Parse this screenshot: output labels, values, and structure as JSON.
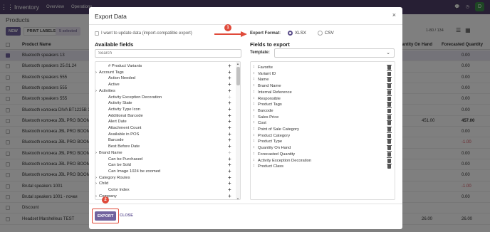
{
  "app": {
    "title": "Inventory",
    "menu": [
      "Overview",
      "Operations"
    ],
    "avatar_letter": "D"
  },
  "page": {
    "breadcrumb": "Products",
    "new_label": "NEW",
    "print_labels": "PRINT LABELS",
    "selected_badge": "5 selected",
    "pager": "1-80 / 134"
  },
  "table": {
    "headers": {
      "name": "Product Name",
      "on_hand": "Quantity On Hand",
      "forecast": "Forecasted Quantity"
    },
    "rows": [
      {
        "name": "Bluetooth speakers 13",
        "on_hand": "",
        "forecast": "0.00",
        "selected": true
      },
      {
        "name": "Bluetooth speakers 25.01.24",
        "on_hand": "",
        "forecast": "0.00",
        "selected": false
      },
      {
        "name": "Bluetooth speakers 555",
        "on_hand": "",
        "forecast": "0.00",
        "selected": false
      },
      {
        "name": "Bluetooth speakers 555",
        "on_hand": "",
        "forecast": "0.00",
        "selected": false
      },
      {
        "name": "Bluetooth speakers 555",
        "on_hand": "",
        "forecast": "0.00",
        "selected": false
      },
      {
        "name": "Bluetooth колонка DIVA BT1225B 3",
        "on_hand": "",
        "forecast": "0.00",
        "selected": false
      },
      {
        "name": "Bluetooth колонка JBL PRO BOOMBI",
        "on_hand": "451.00",
        "forecast": "457.00",
        "selected": false
      },
      {
        "name": "Bluetooth колонка JBL PRO BOOMBI",
        "on_hand": "",
        "forecast": "0.00",
        "selected": false
      },
      {
        "name": "Bluetooth колонка JBL PRO BOOMBI",
        "on_hand": "",
        "forecast": "-1.00",
        "selected": false
      },
      {
        "name": "Bluetooth колонка JBL PRO BOOMBI",
        "on_hand": "",
        "forecast": "0.00",
        "selected": false
      },
      {
        "name": "Bluetooth колонка JBL PRO BOOMBI",
        "on_hand": "",
        "forecast": "0.00",
        "selected": false
      },
      {
        "name": "Bluetooth колонка JBL PRO BOOMBI",
        "on_hand": "",
        "forecast": "0.00",
        "selected": false
      },
      {
        "name": "Brutal speakers 1001",
        "on_hand": "",
        "forecast": "-1.00",
        "selected": false
      },
      {
        "name": "Brutal speakers 1001 - почки",
        "on_hand": "",
        "forecast": "0.00",
        "selected": false
      },
      {
        "name": "Discount",
        "on_hand": "",
        "forecast": "",
        "selected": false
      },
      {
        "name": "Headset Marshelleus TEST",
        "on_hand": "26.00",
        "forecast": "26.00",
        "selected": false
      }
    ]
  },
  "modal": {
    "title": "Export Data",
    "close_icon": "×",
    "import_compat_label": "I want to update data (import-compatible export)",
    "export_format_label": "Export Format:",
    "formats": [
      {
        "label": "XLSX",
        "checked": true
      },
      {
        "label": "CSV",
        "checked": false
      }
    ],
    "available_title": "Available fields",
    "search_placeholder": "Search",
    "export_title": "Fields to export",
    "template_label": "Template:",
    "available_fields": [
      {
        "label": "# Product Variants",
        "expandable": false,
        "can_add": true
      },
      {
        "label": "Account Tags",
        "expandable": true,
        "can_add": true
      },
      {
        "label": "Action Needed",
        "expandable": false,
        "can_add": true
      },
      {
        "label": "Active",
        "expandable": false,
        "can_add": true
      },
      {
        "label": "Activities",
        "expandable": true,
        "can_add": true
      },
      {
        "label": "Activity Exception Decoration",
        "expandable": false,
        "can_add": false
      },
      {
        "label": "Activity State",
        "expandable": false,
        "can_add": true
      },
      {
        "label": "Activity Type Icon",
        "expandable": false,
        "can_add": true
      },
      {
        "label": "Additional Barcode",
        "expandable": false,
        "can_add": true
      },
      {
        "label": "Alert Date",
        "expandable": false,
        "can_add": true
      },
      {
        "label": "Attachment Count",
        "expandable": false,
        "can_add": true
      },
      {
        "label": "Available in POS",
        "expandable": false,
        "can_add": true
      },
      {
        "label": "Barcode",
        "expandable": false,
        "can_add": true
      },
      {
        "label": "Best Before Date",
        "expandable": false,
        "can_add": true
      },
      {
        "label": "Brand Name",
        "expandable": true,
        "can_add": false
      },
      {
        "label": "Can be Purchased",
        "expandable": false,
        "can_add": true
      },
      {
        "label": "Can be Sold",
        "expandable": false,
        "can_add": true
      },
      {
        "label": "Can Image 1024 be zoomed",
        "expandable": false,
        "can_add": true
      },
      {
        "label": "Category Routes",
        "expandable": true,
        "can_add": true
      },
      {
        "label": "Child",
        "expandable": true,
        "can_add": true
      },
      {
        "label": "Color Index",
        "expandable": false,
        "can_add": true
      },
      {
        "label": "Company",
        "expandable": true,
        "can_add": true
      }
    ],
    "export_fields": [
      "Favorite",
      "Variant ID",
      "Name",
      "Brand Name",
      "Internal Reference",
      "Responsible",
      "Product Tags",
      "Barcode",
      "Sales Price",
      "Cost",
      "Point of Sale Category",
      "Product Category",
      "Product Type",
      "Quantity On Hand",
      "Forecasted Quantity",
      "Activity Exception Decoration",
      "Product Class"
    ],
    "export_button": "EXPORT",
    "close_button": "CLOSE"
  },
  "annotations": {
    "step1": "1",
    "step2": "2",
    "accent_color": "#e04a3a"
  },
  "colors": {
    "primary": "#71639e",
    "topbar": "#4e3f69",
    "negative": "#d44c59"
  }
}
